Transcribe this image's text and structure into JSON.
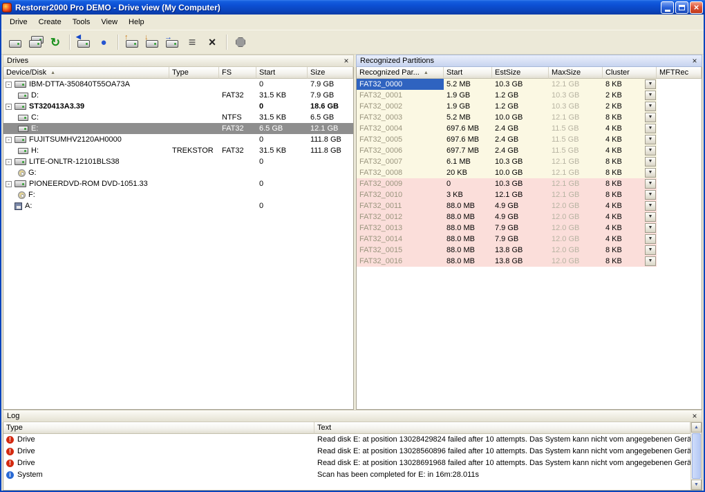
{
  "window": {
    "title": "Restorer2000 Pro DEMO - Drive view (My Computer)"
  },
  "menu": {
    "items": [
      "Drive",
      "Create",
      "Tools",
      "View",
      "Help"
    ]
  },
  "toolbar": {
    "buttons": [
      {
        "icon": "drive-icon"
      },
      {
        "icon": "copy-drives-icon"
      },
      {
        "icon": "refresh-icon"
      },
      {
        "icon": "open-drive-icon"
      },
      {
        "icon": "scan-icon"
      },
      {
        "icon": "open-image-icon"
      },
      {
        "icon": "create-image-icon"
      },
      {
        "icon": "export-icon"
      },
      {
        "icon": "properties-icon"
      },
      {
        "icon": "close-drive-icon"
      },
      {
        "icon": "stop-icon"
      }
    ]
  },
  "glyphs": {
    "close": "×",
    "sort_asc": "▲",
    "dropdown": "▼",
    "scroll_up": "▲",
    "scroll_down": "▼",
    "expander_collapse": "-",
    "error": "!",
    "info": "i"
  },
  "drives_panel": {
    "title": "Drives",
    "columns": [
      "Device/Disk",
      "Type",
      "FS",
      "Start",
      "Size"
    ],
    "rows": [
      {
        "name": "IBM-DTTA-350840T55OA73A",
        "level": 0,
        "icon": "disk",
        "expander": true,
        "start": "0",
        "size": "7.9 GB"
      },
      {
        "name": "D:",
        "level": 1,
        "icon": "volume",
        "fs": "FAT32",
        "start": "31.5 KB",
        "size": "7.9 GB"
      },
      {
        "name": "ST320413A3.39",
        "level": 0,
        "icon": "disk",
        "expander": true,
        "bold": true,
        "start": "0",
        "size": "18.6 GB"
      },
      {
        "name": "C:",
        "level": 1,
        "icon": "volume",
        "fs": "NTFS",
        "start": "31.5 KB",
        "size": "6.5 GB"
      },
      {
        "name": "E:",
        "level": 1,
        "icon": "volume",
        "fs": "FAT32",
        "start": "6.5 GB",
        "size": "12.1 GB",
        "selected": true
      },
      {
        "name": "FUJITSUMHV2120AH0000",
        "level": 0,
        "icon": "disk",
        "expander": true,
        "start": "0",
        "size": "111.8 GB"
      },
      {
        "name": "H:",
        "level": 1,
        "icon": "volume",
        "type": "TREKSTOR",
        "fs": "FAT32",
        "start": "31.5 KB",
        "size": "111.8 GB"
      },
      {
        "name": "LITE-ONLTR-12101BLS38",
        "level": 0,
        "icon": "disk",
        "expander": true,
        "start": "0"
      },
      {
        "name": "G:",
        "level": 1,
        "icon": "cd"
      },
      {
        "name": "PIONEERDVD-ROM DVD-1051.33",
        "level": 0,
        "icon": "disk",
        "expander": true,
        "start": "0"
      },
      {
        "name": "F:",
        "level": 1,
        "icon": "cd"
      },
      {
        "name": "A:",
        "level": 0,
        "icon": "floppy",
        "start": "0"
      }
    ]
  },
  "recognized_panel": {
    "title": "Recognized Partitions",
    "columns": [
      "Recognized Par...",
      "Start",
      "EstSize",
      "MaxSize",
      "Cluster",
      "MFTRec"
    ],
    "rows": [
      {
        "name": "FAT32_0000",
        "start": "5.2 MB",
        "est": "10.3 GB",
        "max": "12.1 GB",
        "cluster": "8 KB",
        "group": "yellow",
        "selected": true
      },
      {
        "name": "FAT32_0001",
        "start": "1.9 GB",
        "est": "1.2 GB",
        "max": "10.3 GB",
        "cluster": "2 KB",
        "group": "yellow"
      },
      {
        "name": "FAT32_0002",
        "start": "1.9 GB",
        "est": "1.2 GB",
        "max": "10.3 GB",
        "cluster": "2 KB",
        "group": "yellow"
      },
      {
        "name": "FAT32_0003",
        "start": "5.2 MB",
        "est": "10.0 GB",
        "max": "12.1 GB",
        "cluster": "8 KB",
        "group": "yellow"
      },
      {
        "name": "FAT32_0004",
        "start": "697.6 MB",
        "est": "2.4 GB",
        "max": "11.5 GB",
        "cluster": "4 KB",
        "group": "yellow"
      },
      {
        "name": "FAT32_0005",
        "start": "697.6 MB",
        "est": "2.4 GB",
        "max": "11.5 GB",
        "cluster": "4 KB",
        "group": "yellow"
      },
      {
        "name": "FAT32_0006",
        "start": "697.7 MB",
        "est": "2.4 GB",
        "max": "11.5 GB",
        "cluster": "4 KB",
        "group": "yellow"
      },
      {
        "name": "FAT32_0007",
        "start": "6.1 MB",
        "est": "10.3 GB",
        "max": "12.1 GB",
        "cluster": "8 KB",
        "group": "yellow"
      },
      {
        "name": "FAT32_0008",
        "start": "20 KB",
        "est": "10.0 GB",
        "max": "12.1 GB",
        "cluster": "8 KB",
        "group": "yellow"
      },
      {
        "name": "FAT32_0009",
        "start": "0",
        "est": "10.3 GB",
        "max": "12.1 GB",
        "cluster": "8 KB",
        "group": "pink"
      },
      {
        "name": "FAT32_0010",
        "start": "3 KB",
        "est": "12.1 GB",
        "max": "12.1 GB",
        "cluster": "8 KB",
        "group": "pink"
      },
      {
        "name": "FAT32_0011",
        "start": "88.0 MB",
        "est": "4.9 GB",
        "max": "12.0 GB",
        "cluster": "4 KB",
        "group": "pink"
      },
      {
        "name": "FAT32_0012",
        "start": "88.0 MB",
        "est": "4.9 GB",
        "max": "12.0 GB",
        "cluster": "4 KB",
        "group": "pink"
      },
      {
        "name": "FAT32_0013",
        "start": "88.0 MB",
        "est": "7.9 GB",
        "max": "12.0 GB",
        "cluster": "4 KB",
        "group": "pink"
      },
      {
        "name": "FAT32_0014",
        "start": "88.0 MB",
        "est": "7.9 GB",
        "max": "12.0 GB",
        "cluster": "4 KB",
        "group": "pink"
      },
      {
        "name": "FAT32_0015",
        "start": "88.0 MB",
        "est": "13.8 GB",
        "max": "12.0 GB",
        "cluster": "8 KB",
        "group": "pink"
      },
      {
        "name": "FAT32_0016",
        "start": "88.0 MB",
        "est": "13.8 GB",
        "max": "12.0 GB",
        "cluster": "8 KB",
        "group": "pink"
      }
    ]
  },
  "log_panel": {
    "title": "Log",
    "columns": [
      "Type",
      "Text"
    ],
    "rows": [
      {
        "type": "Drive",
        "icon": "error",
        "text": "Read disk E: at position 13028429824 failed after 10 attempts. Das System kann nicht vom angegebenen Gerä..."
      },
      {
        "type": "Drive",
        "icon": "error",
        "text": "Read disk E: at position 13028560896 failed after 10 attempts. Das System kann nicht vom angegebenen Gerä..."
      },
      {
        "type": "Drive",
        "icon": "error",
        "text": "Read disk E: at position 13028691968 failed after 10 attempts. Das System kann nicht vom angegebenen Gerä..."
      },
      {
        "type": "System",
        "icon": "info",
        "text": "Scan has been completed for E: in 16m:28.011s"
      }
    ]
  },
  "colors": {
    "titlebar_blue": "#0d50d4",
    "selection_blue": "#2f63c0",
    "selection_gray": "#8e8e8e",
    "group_yellow": "#fbf8e3",
    "group_pink": "#fbdeda",
    "error_red": "#d42a10",
    "info_blue": "#2a6ad4"
  }
}
